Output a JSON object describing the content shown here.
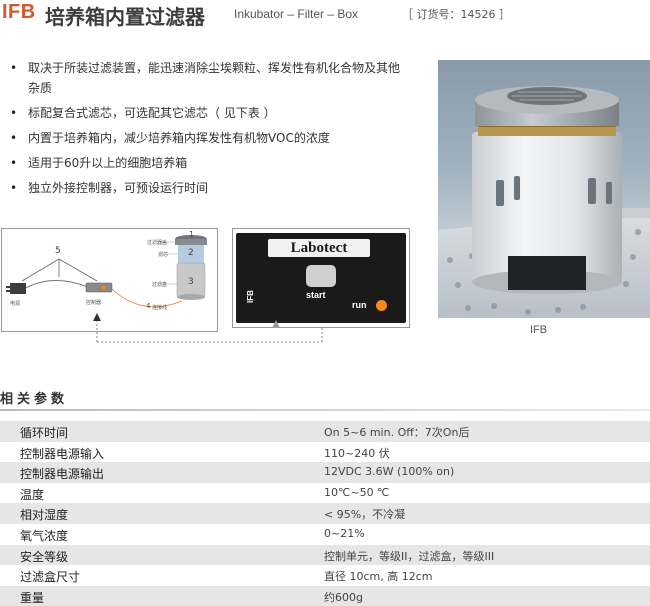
{
  "header": {
    "model": "IFB",
    "title_cn": "培养箱内置过滤器",
    "subtitle_en": "Inkubator – Filter – Box",
    "order": "［ 订货号：14526 ］"
  },
  "features": [
    "取决于所装过滤装置，能迅速消除尘埃颗粒、挥发性有机化合物及其他杂质",
    "标配复合式滤芯，可选配其它滤芯（ 见下表 ）",
    "内置于培养箱内，减少培养箱内挥发性有机物VOC的浓度",
    "适用于60升以上的细胞培养箱",
    "独立外接控制器，可预设运行时间"
  ],
  "photo": {
    "caption": "IFB"
  },
  "diagram": {
    "num_1": "1",
    "num_2": "2",
    "num_3": "3",
    "num_4": "4",
    "num_5": "5",
    "label_filter_cover": "过滤器盖",
    "label_cartridge": "滤芯",
    "label_filter_box": "过滤盒",
    "label_connect_cable": "连接线",
    "label_power": "电源",
    "label_controller": "控制器"
  },
  "controller": {
    "brand": "Labotect",
    "start_label": "start",
    "run_label": "run",
    "model_label": "IFB",
    "colors": {
      "run_led": "#f28a1c"
    }
  },
  "section": {
    "title": "相关参数"
  },
  "params": [
    {
      "name": "循环时间",
      "value": "On 5~6 min.     Off：7次On后"
    },
    {
      "name": "控制器电源输入",
      "value": "110~240 伏"
    },
    {
      "name": "控制器电源输出",
      "value": "12VDC  3.6W (100% on)"
    },
    {
      "name": "温度",
      "value": "10℃~50 ℃"
    },
    {
      "name": "相对湿度",
      "value": "< 95%，不冷凝"
    },
    {
      "name": "氧气浓度",
      "value": "0~21%"
    },
    {
      "name": "安全等级",
      "value": "控制单元，等级II，过滤盒，等级III"
    },
    {
      "name": "过滤盒尺寸",
      "value": "直径 10cm, 高 12cm"
    },
    {
      "name": "重量",
      "value": "约600g"
    }
  ]
}
